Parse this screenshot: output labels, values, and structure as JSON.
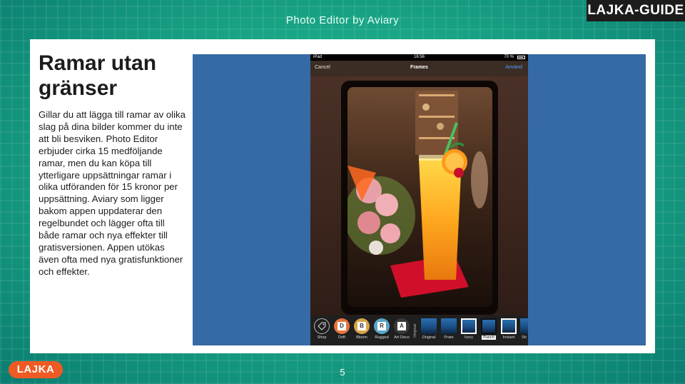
{
  "header": {
    "top_title": "Photo Editor by Aviary",
    "guide_label": "LAJKA-GUIDE"
  },
  "article": {
    "headline": "Ramar utan gränser",
    "body": "Gillar du att lägga till ramar av olika slag på dina bilder kommer du inte att bli besviken. Photo Editor erbjuder cirka 15 medföljande ramar, men du kan köpa till ytterligare uppsättningar ramar i olika utföranden för 15 kronor per uppsättning. Aviary som ligger bakom appen uppdaterar den regelbundet och lägger ofta till både ramar och nya effekter till gratisversionen. Appen utökas även ofta med nya gratisfunktioner och effekter."
  },
  "ipad": {
    "status": {
      "device": "iPad",
      "time": "16:56",
      "battery": "70 %"
    },
    "nav": {
      "cancel": "Cancel",
      "title": "Frames",
      "apply": "Använd"
    },
    "tools": [
      {
        "label": "Shop",
        "icon": "tag-icon",
        "letter": ""
      },
      {
        "label": "Drift",
        "icon": "frame-pack-icon",
        "letter": "D",
        "color": "#e8743a"
      },
      {
        "label": "Bloom",
        "icon": "frame-pack-icon",
        "letter": "B",
        "color": "#d9a54a"
      },
      {
        "label": "Rugged",
        "icon": "frame-pack-icon",
        "letter": "R",
        "color": "#5aa6c8"
      },
      {
        "label": "Art Deco",
        "icon": "frame-pack-icon",
        "letter": "A",
        "color": "#3a3a3a"
      }
    ],
    "original_label": "Original",
    "thumbnails": [
      {
        "label": "Original",
        "selected": false
      },
      {
        "label": "Prato",
        "selected": false
      },
      {
        "label": "Ivory",
        "selected": false
      },
      {
        "label": "Punch",
        "selected": true
      },
      {
        "label": "Instant",
        "selected": false
      },
      {
        "label": "Sh",
        "selected": false
      }
    ]
  },
  "footer": {
    "logo": "LAJKA",
    "page_number": "5"
  },
  "colors": {
    "accent_blue": "#356aa5",
    "logo_orange": "#ef5a24",
    "apply_blue": "#4fa3ff"
  }
}
